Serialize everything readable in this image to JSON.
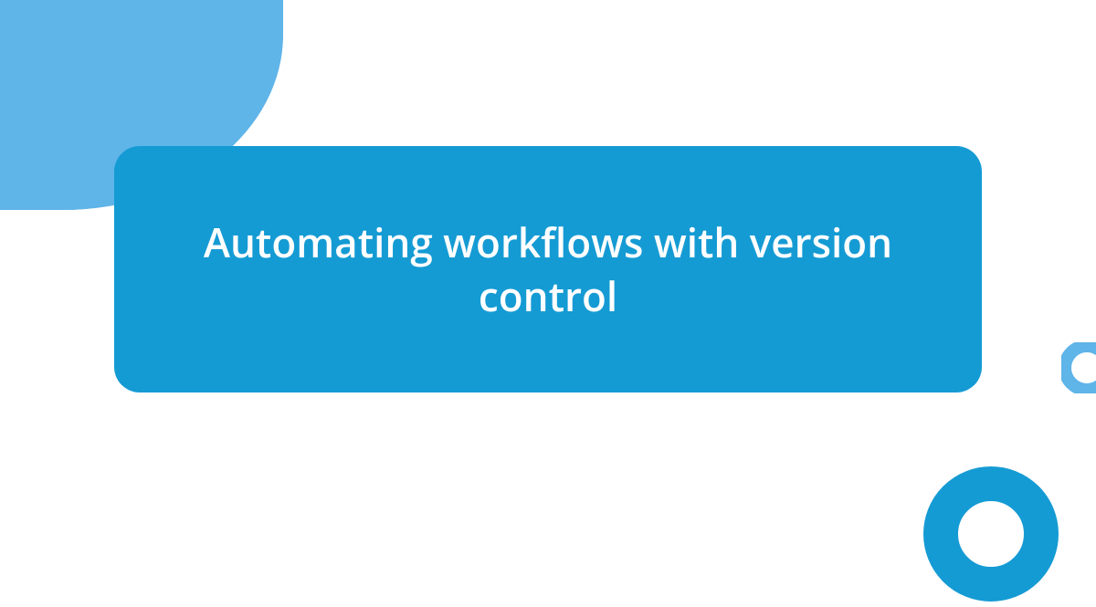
{
  "card": {
    "title": "Automating workflows with version control"
  },
  "colors": {
    "primary": "#159bd4",
    "light": "#5fb4e8",
    "background": "#ffffff"
  }
}
